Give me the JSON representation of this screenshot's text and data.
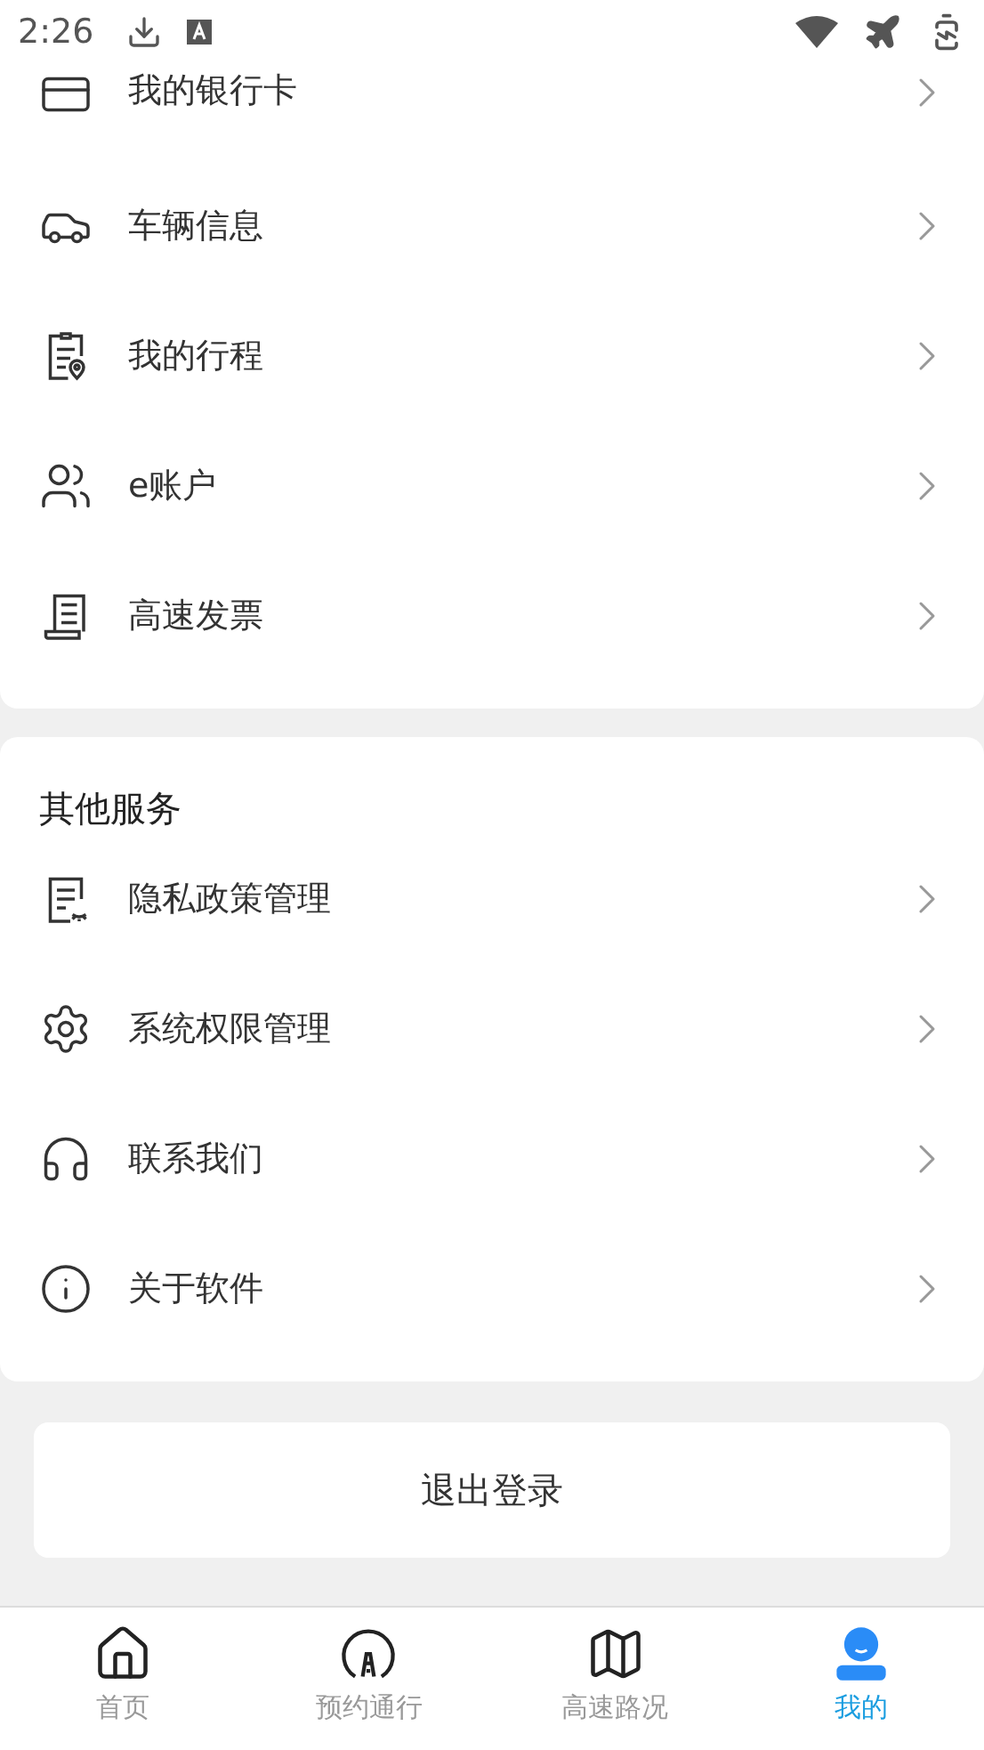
{
  "status_bar": {
    "time": "2:26"
  },
  "account_card": {
    "items": [
      {
        "label": "我的银行卡"
      },
      {
        "label": "车辆信息"
      },
      {
        "label": "我的行程"
      },
      {
        "label": "e账户"
      },
      {
        "label": "高速发票"
      }
    ]
  },
  "other_services": {
    "title": "其他服务",
    "items": [
      {
        "label": "隐私政策管理"
      },
      {
        "label": "系统权限管理"
      },
      {
        "label": "联系我们"
      },
      {
        "label": "关于软件"
      }
    ]
  },
  "logout_button": {
    "label": "退出登录"
  },
  "tab_bar": [
    {
      "label": "首页",
      "selected": false
    },
    {
      "label": "预约通行",
      "selected": false
    },
    {
      "label": "高速路况",
      "selected": false
    },
    {
      "label": "我的",
      "selected": true
    }
  ]
}
